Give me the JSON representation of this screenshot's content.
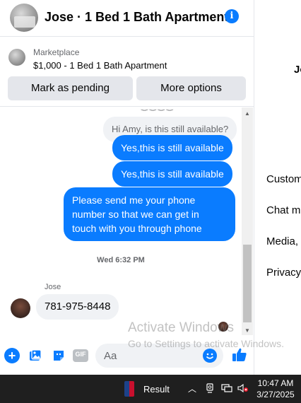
{
  "header": {
    "title": "Jose · 1 Bed 1 Bath Apartment",
    "info_icon": "i"
  },
  "listing": {
    "source": "Marketplace",
    "title": "$1,000 - 1 Bed 1 Bath Apartment",
    "mark_pending_label": "Mark as pending",
    "more_options_label": "More options"
  },
  "messages": {
    "ghost_question": "Hi Amy, is this still available?",
    "sent_1": "Yes,this is still available",
    "sent_2": "Yes,this is still available",
    "sent_3_line1": "Please send me your phone",
    "sent_3_line2": "number so that we can get in",
    "sent_3_line3": "touch with you through phone",
    "timestamp": "Wed 6:32 PM",
    "sender_name": "Jose",
    "received_1": "781-975-8448"
  },
  "composer": {
    "placeholder": "Aa",
    "gif_label": "GIF"
  },
  "watermark": {
    "title": "Activate Windows",
    "subtitle": "Go to Settings to activate Windows."
  },
  "right_pane": {
    "name_fragment": "Jo",
    "items": [
      "Custom",
      "Chat m",
      "Media,",
      "Privacy"
    ]
  },
  "taskbar": {
    "result_label": "Result",
    "time": "10:47 AM",
    "date": "3/27/2025"
  },
  "colors": {
    "accent": "#0a7cff",
    "bubble_received": "#f0f2f5",
    "taskbar": "#1f1f1f"
  }
}
